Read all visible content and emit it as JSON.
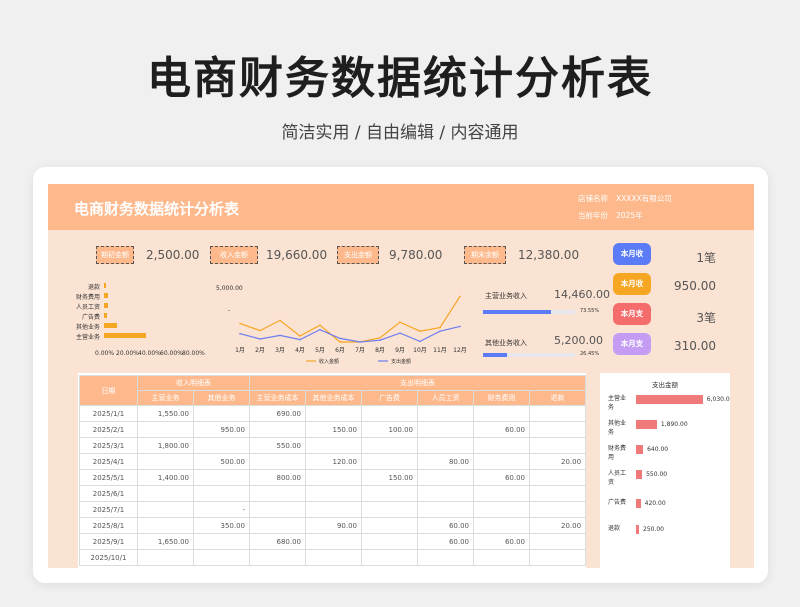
{
  "page": {
    "title": "电商财务数据统计分析表",
    "subtitle": "简洁实用 / 自由编辑 / 内容通用"
  },
  "sheet": {
    "title": "电商财务数据统计分析表",
    "meta": [
      {
        "label": "店铺名称",
        "value": "XXXXX有限公司"
      },
      {
        "label": "当前年份",
        "value": "2025年"
      }
    ],
    "kpis": [
      {
        "label": "期初金额",
        "value": "2,500.00"
      },
      {
        "label": "收入金额",
        "value": "19,660.00"
      },
      {
        "label": "支出金额",
        "value": "9,780.00"
      },
      {
        "label": "期末余额",
        "value": "12,380.00"
      }
    ],
    "month_summary": [
      {
        "label": "本月收",
        "value": "1笔",
        "color": "#5b7cf6"
      },
      {
        "label": "本月收",
        "value": "950.00",
        "color": "#f5a623"
      },
      {
        "label": "本月支",
        "value": "3笔",
        "color": "#f46c6c"
      },
      {
        "label": "本月支",
        "value": "310.00",
        "color": "#c59cf3"
      }
    ],
    "income_split": [
      {
        "label": "主营业务收入",
        "value": "14,460.00",
        "pct": "73.55%",
        "fraction": 0.7355,
        "color": "#5b7cf6"
      },
      {
        "label": "其他业务收入",
        "value": "5,200.00",
        "pct": "26.45%",
        "fraction": 0.2645,
        "color": "#5b7cf6"
      }
    ]
  },
  "chart_data": [
    {
      "type": "bar",
      "orientation": "horizontal",
      "categories": [
        "退款",
        "财务费用",
        "人员工资",
        "广告费",
        "其他业务",
        "主营业务"
      ],
      "values": [
        0.0128,
        0.0307,
        0.0281,
        0.0215,
        0.0967,
        0.3086
      ],
      "top_label": "5,000.00",
      "tick_labels": [
        "0.00%",
        "20.00%",
        "40.00%",
        "60.00%",
        "80.00%"
      ],
      "xlim": [
        0,
        0.8
      ],
      "color": "#f5a623"
    },
    {
      "type": "line",
      "categories": [
        "1月",
        "2月",
        "3月",
        "4月",
        "5月",
        "6月",
        "7月",
        "8月",
        "9月",
        "10月",
        "11月",
        "12月"
      ],
      "series": [
        {
          "name": "收入金额",
          "values": [
            1550,
            950,
            1800,
            500,
            1400,
            0,
            0,
            350,
            1650,
            900,
            1200,
            3800
          ],
          "color": "#f5a623"
        },
        {
          "name": "支出金额",
          "values": [
            690,
            250,
            550,
            200,
            1030,
            300,
            0,
            150,
            740,
            50,
            900,
            1300
          ],
          "color": "#6b7cf0"
        }
      ],
      "y_marker": "-",
      "ylim": [
        0,
        4500
      ]
    },
    {
      "type": "bar",
      "orientation": "horizontal",
      "title": "支出金额",
      "categories": [
        "主营业务",
        "其他业务",
        "财务费用",
        "人员工资",
        "广告费",
        "退款"
      ],
      "values": [
        6030,
        1890,
        640,
        550,
        420,
        250
      ],
      "value_labels": [
        "6,030.00",
        "1,890.00",
        "640.00",
        "550.00",
        "420.00",
        "250.00"
      ],
      "xlim": [
        0,
        6500
      ],
      "color": "#f07a7a"
    }
  ],
  "table": {
    "date_header": "日期",
    "group_headers": {
      "income": "收入明细表",
      "expense": "支出明细表"
    },
    "columns": [
      "主营业务",
      "其他业务",
      "主营业务成本",
      "其他业务成本",
      "广告费",
      "人员工资",
      "财务费用",
      "退款"
    ],
    "rows": [
      [
        "2025/1/1",
        "1,550.00",
        "",
        "690.00",
        "",
        "",
        "",
        "",
        ""
      ],
      [
        "2025/2/1",
        "",
        "950.00",
        "",
        "150.00",
        "100.00",
        "",
        "60.00",
        ""
      ],
      [
        "2025/3/1",
        "1,800.00",
        "",
        "550.00",
        "",
        "",
        "",
        "",
        ""
      ],
      [
        "2025/4/1",
        "",
        "500.00",
        "",
        "120.00",
        "",
        "80.00",
        "",
        "20.00"
      ],
      [
        "2025/5/1",
        "1,400.00",
        "",
        "800.00",
        "",
        "150.00",
        "",
        "60.00",
        ""
      ],
      [
        "2025/6/1",
        "",
        "",
        "",
        "",
        "",
        "",
        "",
        ""
      ],
      [
        "2025/7/1",
        "",
        "-",
        "",
        "",
        "",
        "",
        "",
        ""
      ],
      [
        "2025/8/1",
        "",
        "350.00",
        "",
        "90.00",
        "",
        "60.00",
        "",
        "20.00"
      ],
      [
        "2025/9/1",
        "1,650.00",
        "",
        "680.00",
        "",
        "",
        "60.00",
        "60.00",
        ""
      ],
      [
        "2025/10/1",
        "",
        "",
        "",
        "",
        "",
        "",
        "",
        ""
      ]
    ]
  }
}
